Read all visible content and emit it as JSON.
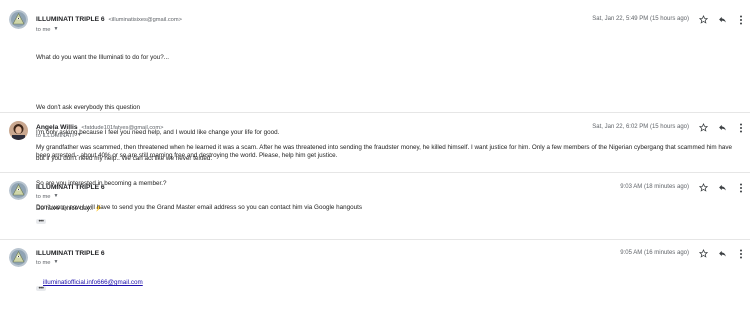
{
  "messages": [
    {
      "sender_name": "ILLUMINATI TRIPLE 6",
      "sender_email": "<illuminatisixes@gmail.com>",
      "to": "to me",
      "time": "Sat, Jan 22, 5:49 PM (15 hours ago)",
      "avatar": "illuminati-pyramid-logo",
      "body_lines": [
        "What do you want the Illuminati to do for you?...",
        "",
        "We don't ask everybody this question",
        "I'm only asking because I feel you need help, and I would like change your life for good.",
        "but if you don't need my help.. We can act like we never texted.",
        "So are you interested in becoming a member.?",
        "Do have a nice day.. ⚡"
      ]
    },
    {
      "sender_name": "Angela Willis",
      "sender_email": "<fatdude101fatyes@gmail.com>",
      "to": "to ILLUMINATI",
      "time": "Sat, Jan 22, 6:02 PM (15 hours ago)",
      "avatar": "profile-photo",
      "body": "My grandfather was scammed, then threatened when he learned it was a scam. After he was threatened into sending the fraudster money, he killed himself. I want justice for him. Only a few members of the Nigerian cybergang that scammed him have been arrested - about 40% or so are still roaming free and destroying the world. Please, help him get justice."
    },
    {
      "sender_name": "ILLUMINATI TRIPLE 6",
      "to": "to me",
      "time": "9:03 AM (18 minutes ago)",
      "avatar": "illuminati-pyramid-logo",
      "body": "Don't worry now I will have to send you the Grand Master email address so you can contact him via Google hangouts",
      "more": "•••"
    },
    {
      "sender_name": "ILLUMINATI TRIPLE 6",
      "to": "to me",
      "time": "9:05 AM (16 minutes ago)",
      "avatar": "illuminati-pyramid-logo",
      "link": "illuminatiofficial.info666@gmail.com",
      "more": "•••"
    }
  ],
  "colors": {
    "text": "#202124",
    "secondary": "#5f6368",
    "link": "#1a0dab",
    "divider": "#e6e6e6"
  },
  "icons": [
    "star-icon",
    "reply-icon",
    "more-vert-icon",
    "chevron-down-icon"
  ]
}
